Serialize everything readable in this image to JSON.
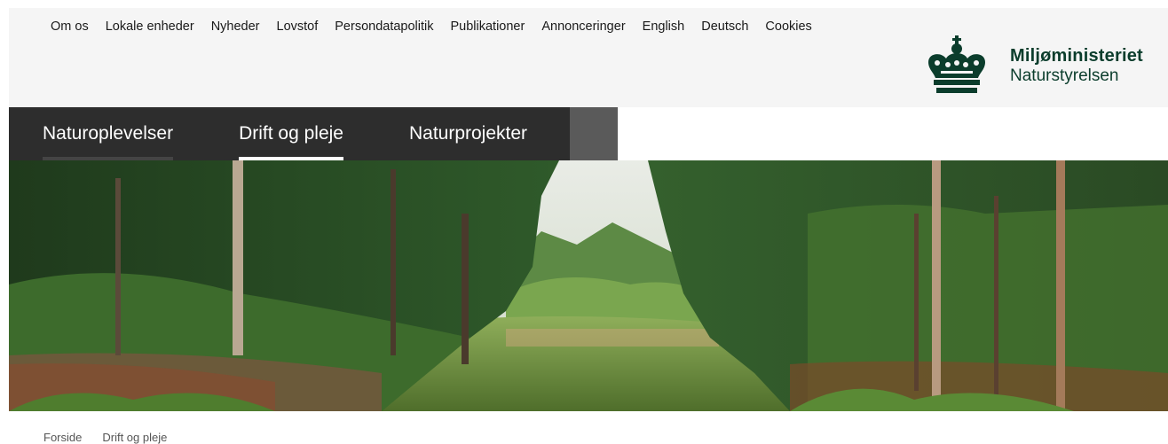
{
  "topnav": {
    "items": [
      "Om os",
      "Lokale enheder",
      "Nyheder",
      "Lovstof",
      "Persondatapolitik",
      "Publikationer",
      "Annonceringer",
      "English",
      "Deutsch",
      "Cookies"
    ]
  },
  "logo": {
    "title": "Miljøministeriet",
    "subtitle": "Naturstyrelsen"
  },
  "mainnav": {
    "items": [
      "Naturoplevelser",
      "Drift og pleje",
      "Naturprojekter"
    ],
    "active": "Drift og pleje"
  },
  "breadcrumb": {
    "items": [
      "Forside",
      "Drift og pleje"
    ]
  },
  "colors": {
    "brand_green": "#0b3d2c",
    "nav_bg": "#2d2d2d",
    "header_bg": "#f5f5f5"
  }
}
